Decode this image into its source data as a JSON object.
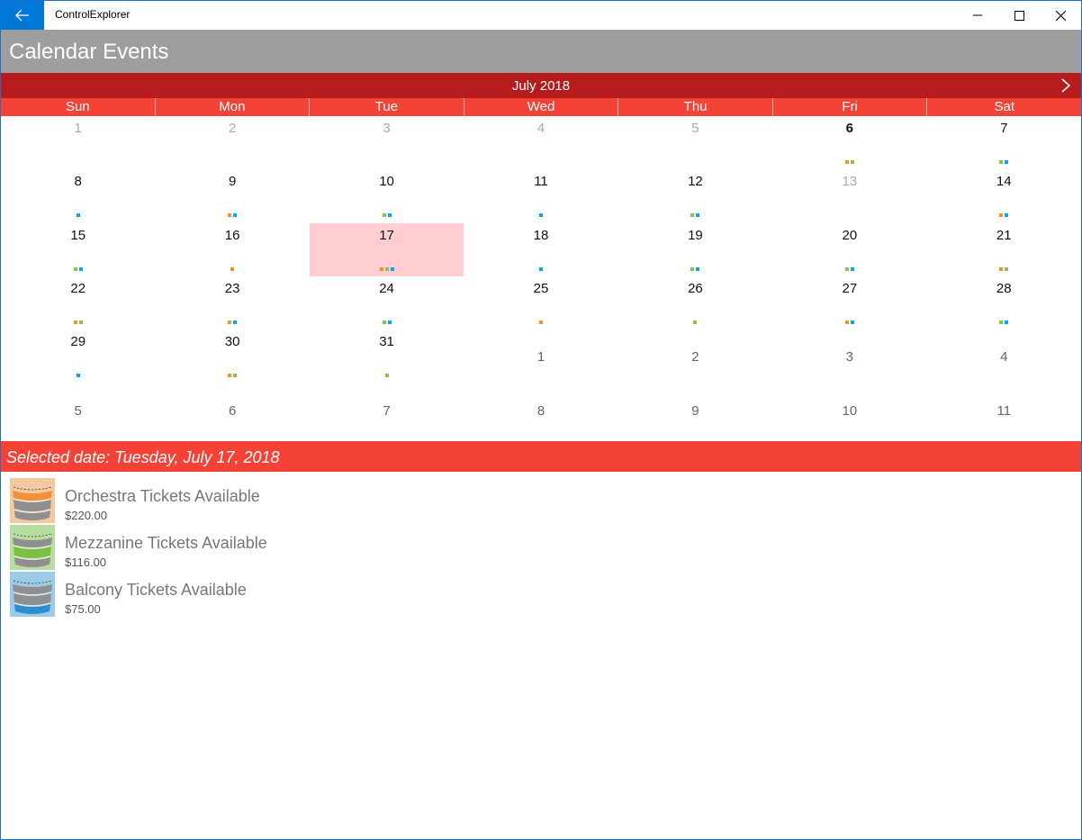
{
  "window": {
    "app_title": "ControlExplorer",
    "back_icon": "arrow-left-icon"
  },
  "header": {
    "title": "Calendar Events"
  },
  "calendar": {
    "month_label": "July 2018",
    "day_names": [
      "Sun",
      "Mon",
      "Tue",
      "Wed",
      "Thu",
      "Fri",
      "Sat"
    ],
    "selected_day": 17,
    "today_day": 6,
    "colors": {
      "orange": "#f39321",
      "green": "#8bc34a",
      "blue": "#03a9f4",
      "selected_bg": "#ffcdd2"
    },
    "weeks": [
      [
        {
          "d": "1",
          "m": "cur",
          "dots": []
        },
        {
          "d": "2",
          "m": "cur",
          "dots": []
        },
        {
          "d": "3",
          "m": "cur",
          "dots": []
        },
        {
          "d": "4",
          "m": "cur",
          "dots": []
        },
        {
          "d": "5",
          "m": "cur",
          "dots": []
        },
        {
          "d": "6",
          "m": "cur",
          "dots": [
            "orange",
            "green"
          ]
        },
        {
          "d": "7",
          "m": "cur",
          "dots": [
            "green",
            "blue"
          ]
        }
      ],
      [
        {
          "d": "8",
          "m": "cur",
          "dots": [
            "blue"
          ]
        },
        {
          "d": "9",
          "m": "cur",
          "dots": [
            "orange",
            "blue"
          ]
        },
        {
          "d": "10",
          "m": "cur",
          "dots": [
            "green",
            "blue"
          ]
        },
        {
          "d": "11",
          "m": "cur",
          "dots": [
            "blue"
          ]
        },
        {
          "d": "12",
          "m": "cur",
          "dots": [
            "green",
            "blue"
          ]
        },
        {
          "d": "13",
          "m": "cur",
          "dots": []
        },
        {
          "d": "14",
          "m": "cur",
          "dots": [
            "orange",
            "blue"
          ]
        }
      ],
      [
        {
          "d": "15",
          "m": "cur",
          "dots": [
            "green",
            "blue"
          ]
        },
        {
          "d": "16",
          "m": "cur",
          "dots": [
            "orange"
          ]
        },
        {
          "d": "17",
          "m": "cur",
          "dots": [
            "orange",
            "green",
            "blue"
          ]
        },
        {
          "d": "18",
          "m": "cur",
          "dots": [
            "blue"
          ]
        },
        {
          "d": "19",
          "m": "cur",
          "dots": [
            "green",
            "blue"
          ]
        },
        {
          "d": "20",
          "m": "cur",
          "dots": [
            "green",
            "blue"
          ]
        },
        {
          "d": "21",
          "m": "cur",
          "dots": [
            "orange",
            "green"
          ]
        }
      ],
      [
        {
          "d": "22",
          "m": "cur",
          "dots": [
            "orange",
            "green"
          ]
        },
        {
          "d": "23",
          "m": "cur",
          "dots": [
            "orange",
            "blue"
          ]
        },
        {
          "d": "24",
          "m": "cur",
          "dots": [
            "green",
            "blue"
          ]
        },
        {
          "d": "25",
          "m": "cur",
          "dots": [
            "orange"
          ]
        },
        {
          "d": "26",
          "m": "cur",
          "dots": [
            "green"
          ]
        },
        {
          "d": "27",
          "m": "cur",
          "dots": [
            "orange",
            "blue"
          ]
        },
        {
          "d": "28",
          "m": "cur",
          "dots": [
            "green",
            "blue"
          ]
        }
      ],
      [
        {
          "d": "29",
          "m": "cur",
          "dots": [
            "blue"
          ]
        },
        {
          "d": "30",
          "m": "cur",
          "dots": [
            "orange",
            "green"
          ]
        },
        {
          "d": "31",
          "m": "cur",
          "dots": [
            "green"
          ]
        },
        {
          "d": "1",
          "m": "next",
          "dots": []
        },
        {
          "d": "2",
          "m": "next",
          "dots": []
        },
        {
          "d": "3",
          "m": "next",
          "dots": []
        },
        {
          "d": "4",
          "m": "next",
          "dots": []
        }
      ],
      [
        {
          "d": "5",
          "m": "next",
          "dots": []
        },
        {
          "d": "6",
          "m": "next",
          "dots": []
        },
        {
          "d": "7",
          "m": "next",
          "dots": []
        },
        {
          "d": "8",
          "m": "next",
          "dots": []
        },
        {
          "d": "9",
          "m": "next",
          "dots": []
        },
        {
          "d": "10",
          "m": "next",
          "dots": []
        },
        {
          "d": "11",
          "m": "next",
          "dots": []
        }
      ]
    ]
  },
  "selection": {
    "text": "Selected date: Tuesday, July 17, 2018"
  },
  "events": [
    {
      "name": "Orchestra Tickets Available",
      "price": "$220.00",
      "bg": "#f5c9a0",
      "band": "orchestra"
    },
    {
      "name": "Mezzanine Tickets Available",
      "price": "$116.00",
      "bg": "#b7dea0",
      "band": "mezzanine"
    },
    {
      "name": "Balcony Tickets Available",
      "price": "$75.00",
      "bg": "#9ccbe6",
      "band": "balcony"
    }
  ]
}
